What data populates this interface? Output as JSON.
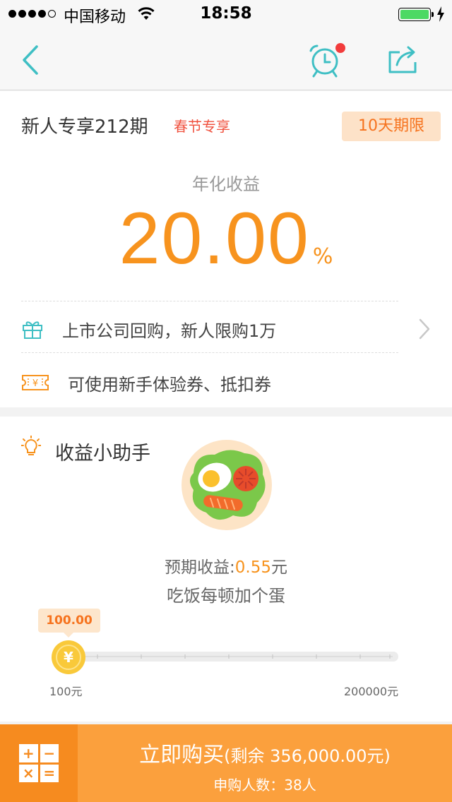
{
  "status_bar": {
    "carrier": "中国移动",
    "time": "18:58",
    "battery_level": 1.0
  },
  "nav": {
    "back_icon": "chevron-left-icon",
    "alarm_icon": "alarm-clock-icon",
    "share_icon": "share-icon",
    "accent_color": "#3fbfc4",
    "alarm_badge_color": "#f23c3c"
  },
  "product": {
    "title": "新人专享212期",
    "tag": "春节专享",
    "term_badge": "10天期限",
    "rate_label": "年化收益",
    "rate_value": "20.00",
    "rate_unit": "%",
    "rows": [
      {
        "icon": "gift-icon",
        "text": "上市公司回购，新人限购1万"
      },
      {
        "icon": "ticket-icon",
        "text": "可使用新手体验券、抵扣券"
      }
    ],
    "accent_color": "#f7931e"
  },
  "assistant": {
    "title": "收益小助手",
    "icon": "lightbulb-icon",
    "illustration": "egg-salad-plate-illustration",
    "expected_label": "预期收益:",
    "expected_value": "0.55",
    "expected_unit": "元",
    "slogan": "吃饭每顿加个蛋",
    "slider": {
      "current": "100.00",
      "min_label": "100元",
      "max_label": "200000元",
      "thumb_icon": "yuan-coin-icon"
    }
  },
  "bottom_bar": {
    "calculator_icon": "calculator-icon",
    "calc_symbols": [
      "+",
      "−",
      "×",
      "="
    ],
    "buy_label": "立即购买",
    "remaining_text": "(剩余 356,000.00元)",
    "buyers_text": "申购人数：38人",
    "buy_color": "#fba03d",
    "calc_color": "#f68b1f"
  }
}
